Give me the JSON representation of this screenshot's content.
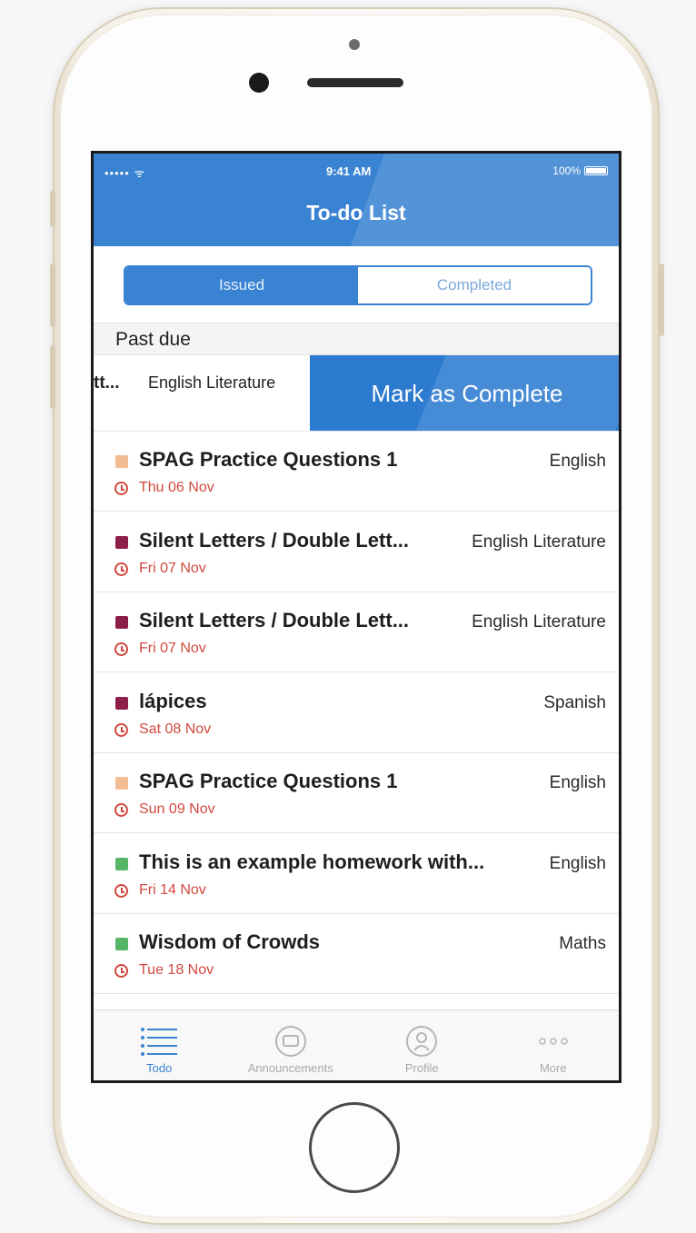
{
  "status_bar": {
    "signal": "••••• ᯤ",
    "time": "9:41 AM",
    "battery": "100%"
  },
  "nav": {
    "title": "To-do List"
  },
  "segment": {
    "issued": "Issued",
    "completed": "Completed"
  },
  "section": {
    "past_due": "Past due"
  },
  "swipe_row": {
    "title": "tt...",
    "subject": "English Literature",
    "action": "Mark as Complete"
  },
  "items": [
    {
      "title": "SPAG Practice Questions 1",
      "subject": "English",
      "date": "Thu 06 Nov",
      "color": "#f3bd94"
    },
    {
      "title": "Silent Letters / Double Lett...",
      "subject": "English Literature",
      "date": "Fri 07 Nov",
      "color": "#8b1f4a"
    },
    {
      "title": "Silent Letters / Double Lett...",
      "subject": "English Literature",
      "date": "Fri 07 Nov",
      "color": "#8b1f4a"
    },
    {
      "title": "lápices",
      "subject": "Spanish",
      "date": "Sat 08 Nov",
      "color": "#8b1f4a"
    },
    {
      "title": "SPAG Practice Questions 1",
      "subject": "English",
      "date": "Sun 09 Nov",
      "color": "#f3bd94"
    },
    {
      "title": "This is an example homework with...",
      "subject": "English",
      "date": "Fri 14 Nov",
      "color": "#55b766"
    },
    {
      "title": "Wisdom of Crowds",
      "subject": "Maths",
      "date": "Tue 18 Nov",
      "color": "#55b766"
    }
  ],
  "tabs": [
    {
      "label": "Todo",
      "icon": "list-icon"
    },
    {
      "label": "Announcements",
      "icon": "announcements-icon"
    },
    {
      "label": "Profile",
      "icon": "profile-icon"
    },
    {
      "label": "More",
      "icon": "more-icon"
    }
  ],
  "colors": {
    "accent": "#3a83d2",
    "overdue": "#d2483e"
  }
}
